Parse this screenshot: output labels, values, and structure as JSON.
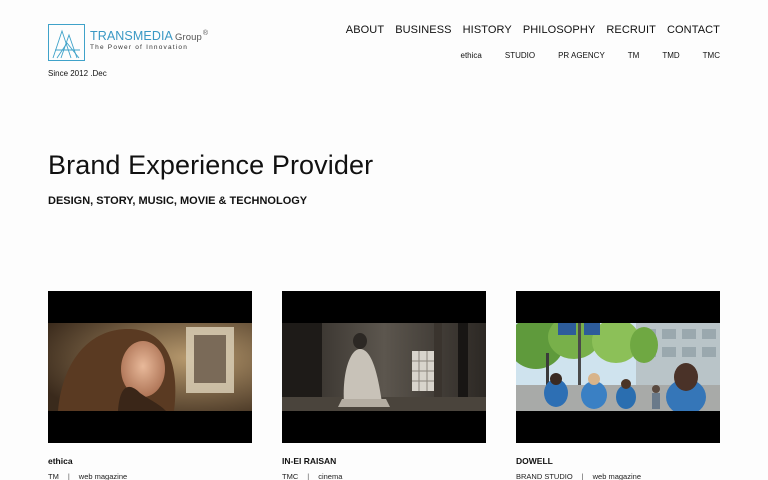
{
  "logo": {
    "brand_main": "TRANSMEDIA",
    "brand_group": "Group",
    "registered": "®",
    "tagline": "The Power of Innovation"
  },
  "since": "Since 2012 .Dec",
  "nav": {
    "main": [
      "ABOUT",
      "BUSINESS",
      "HISTORY",
      "PHILOSOPHY",
      "RECRUIT",
      "CONTACT"
    ],
    "sub": [
      "ethica",
      "STUDIO",
      "PR AGENCY",
      "TM",
      "TMD",
      "TMC"
    ]
  },
  "hero": {
    "headline": "Brand Experience Provider",
    "subline": "DESIGN, STORY, MUSIC, MOVIE & TECHNOLOGY"
  },
  "cards": [
    {
      "title": "ethica",
      "tag1": "TM",
      "separator": "|",
      "tag2": "web magazine",
      "image_icon": "portrait-woman-image"
    },
    {
      "title": "IN-EI RAISAN",
      "tag1": "TMC",
      "separator": "|",
      "tag2": "cinema",
      "image_icon": "japanese-room-image"
    },
    {
      "title": "DOWELL",
      "tag1": "BRAND STUDIO",
      "separator": "|",
      "tag2": "web magazine",
      "image_icon": "street-crowd-image"
    }
  ],
  "colors": {
    "accent": "#3a98c4",
    "text": "#111111",
    "background": "#fdfdfd",
    "thumb_background": "#000000"
  }
}
